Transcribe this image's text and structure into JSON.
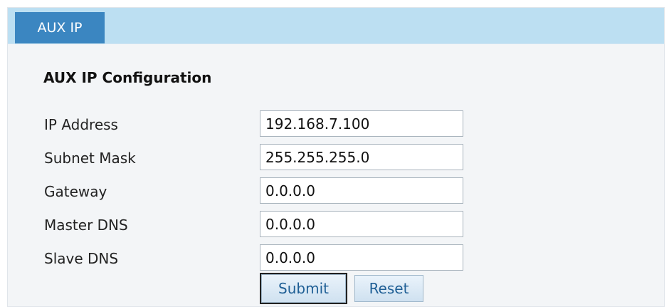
{
  "tabs": [
    {
      "label": "AUX IP",
      "active": true
    }
  ],
  "form": {
    "title": "AUX IP Configuration",
    "fields": [
      {
        "label": "IP Address",
        "value": "192.168.7.100"
      },
      {
        "label": "Subnet Mask",
        "value": "255.255.255.0"
      },
      {
        "label": "Gateway",
        "value": "0.0.0.0"
      },
      {
        "label": "Master DNS",
        "value": "0.0.0.0"
      },
      {
        "label": "Slave DNS",
        "value": "0.0.0.0"
      }
    ],
    "submit_label": "Submit",
    "reset_label": "Reset"
  },
  "colors": {
    "tab_bar": "#bcdff2",
    "active_tab": "#3b86c1",
    "panel_background": "#f3f5f7",
    "button_text": "#1f5f95"
  }
}
